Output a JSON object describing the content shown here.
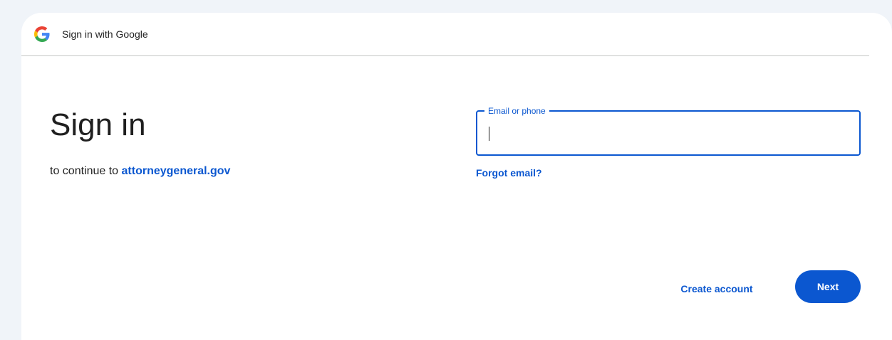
{
  "header": {
    "title": "Sign in with Google",
    "logo_icon": "google-g-icon"
  },
  "main": {
    "title": "Sign in",
    "subtitle_prefix": "to continue to ",
    "site_name": "attorneygeneral.gov"
  },
  "form": {
    "email_label": "Email or phone",
    "email_value": "",
    "forgot_email": "Forgot email?"
  },
  "actions": {
    "create_account": "Create account",
    "next": "Next"
  },
  "colors": {
    "accent": "#0b57d0",
    "background": "#f0f4f9",
    "text": "#1f1f1f"
  }
}
